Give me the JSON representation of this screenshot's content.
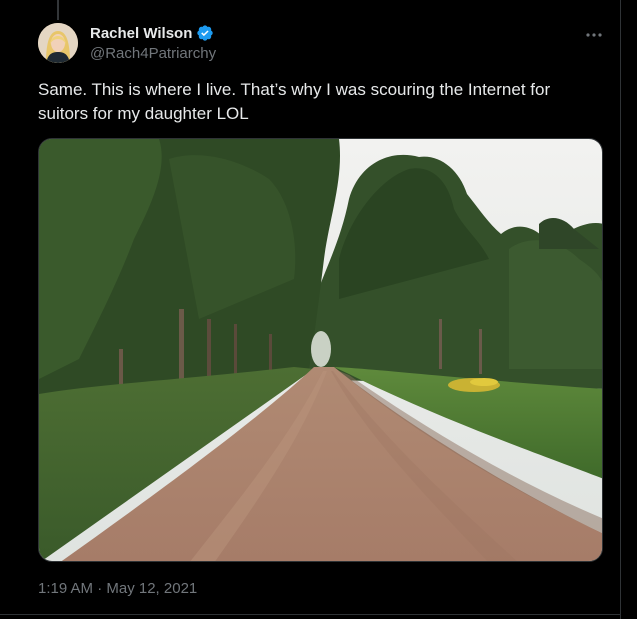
{
  "tweet": {
    "author": {
      "display_name": "Rachel Wilson",
      "handle": "@Rach4Patriarchy",
      "verified": true,
      "avatar_icon": "profile-photo"
    },
    "text": "Same. This is where I live. That’s why I was scouring the Internet for suitors for my daughter LOL",
    "media": {
      "type": "photo",
      "subject": "dirt-road-through-trees"
    },
    "timestamp": "1:19 AM · May 12, 2021",
    "more_icon": "ellipsis-icon"
  },
  "colors": {
    "background": "#000000",
    "text_primary": "#e7e9ea",
    "text_secondary": "#71767b",
    "verified_badge": "#1d9bf0",
    "divider": "#2f3336"
  }
}
